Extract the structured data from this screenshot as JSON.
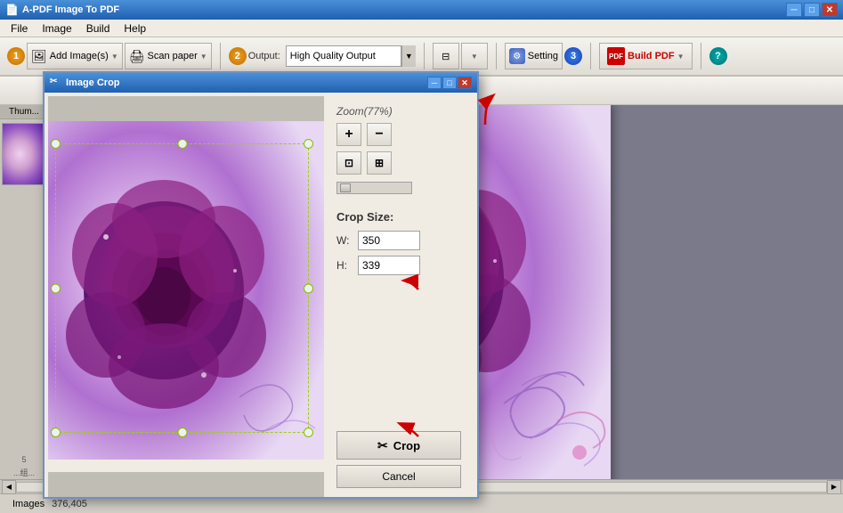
{
  "app": {
    "title": "A-PDF Image To PDF",
    "icon": "📄"
  },
  "title_bar": {
    "title": "A-PDF Image To PDF",
    "controls": [
      "minimize",
      "maximize",
      "close"
    ]
  },
  "menu": {
    "items": [
      "File",
      "Image",
      "Build",
      "Help"
    ]
  },
  "toolbar": {
    "step1": "1",
    "add_image_label": "Add Image(s)",
    "scan_paper_label": "Scan paper",
    "step2": "2",
    "output_label": "Output:",
    "output_value": "High Quality Output",
    "setting_label": "Setting",
    "step3": "3",
    "build_pdf_label": "Build PDF"
  },
  "thumb_panel": {
    "label": "Thum..."
  },
  "crop_dialog": {
    "title": "Image Crop",
    "zoom_label": "Zoom(77%)",
    "crop_size_label": "Crop Size:",
    "width_label": "W:",
    "width_value": "350",
    "height_label": "H:",
    "height_value": "339",
    "crop_button": "Crop",
    "cancel_button": "Cancel"
  },
  "status_bar": {
    "position": "376,405",
    "tab_label": "Images"
  },
  "icons": {
    "crop": "✂",
    "zoom_in": "+",
    "zoom_out": "−",
    "fit_page": "⊡",
    "fit_width": "⊞"
  }
}
